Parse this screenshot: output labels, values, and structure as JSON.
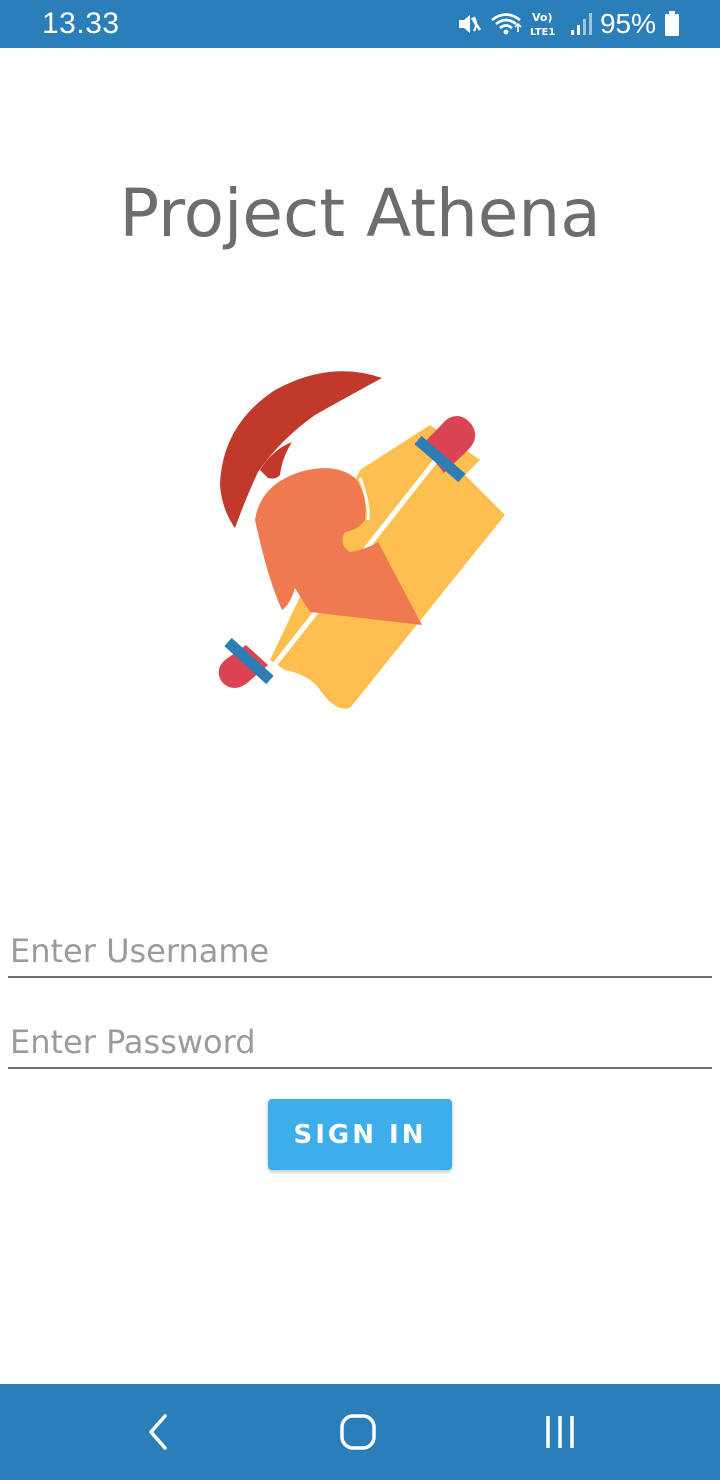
{
  "status_bar": {
    "time": "13.33",
    "battery": "95%",
    "icons": [
      "mute-icon",
      "wifi-icon",
      "volte-icon",
      "signal-icon",
      "battery-icon"
    ],
    "volte_label": "Vo) LTE1",
    "background": "#2a7fbb"
  },
  "app": {
    "title": "Project Athena"
  },
  "logo": {
    "description_icon": "spartan-helmet-scroll-logo",
    "colors": {
      "plume": "#c0392b",
      "helmet": "#f07a50",
      "scroll": "#fdbf4f",
      "scroll_caps": "#dc4453",
      "scroll_bands": "#2e7db5"
    }
  },
  "form": {
    "username_placeholder": "Enter Username",
    "password_placeholder": "Enter Password",
    "signin_label": "SIGN IN",
    "button_color": "#3daee9"
  },
  "nav_bar": {
    "buttons": [
      "back-icon",
      "home-icon",
      "recent-apps-icon"
    ],
    "background": "#2a7fbb"
  }
}
